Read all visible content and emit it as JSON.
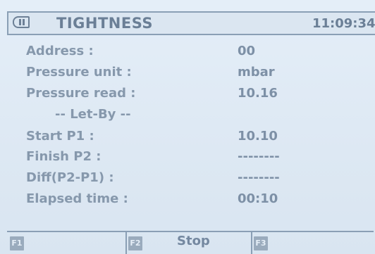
{
  "header": {
    "title": "TIGHTNESS",
    "time": "11:09:34",
    "battery_icon": "battery-icon"
  },
  "rows": [
    {
      "label": "Address :",
      "value": "00"
    },
    {
      "label": "Pressure unit :",
      "value": "mbar"
    },
    {
      "label": "Pressure read :",
      "value": "10.16"
    }
  ],
  "section_title": "-- Let-By --",
  "letby_rows": [
    {
      "label": "Start  P1 :",
      "value": "10.10"
    },
    {
      "label": "Finish  P2 :",
      "value": "--------"
    },
    {
      "label": "Diff(P2-P1) :",
      "value": "--------"
    },
    {
      "label": "Elapsed  time :",
      "value": "00:10"
    }
  ],
  "softkeys": [
    {
      "key": "F1",
      "label": ""
    },
    {
      "key": "F2",
      "label": "Stop"
    },
    {
      "key": "F3",
      "label": ""
    }
  ],
  "colors": {
    "background": "#e2ecf6",
    "text": "#8698ac",
    "frame": "#8a9fb5"
  }
}
